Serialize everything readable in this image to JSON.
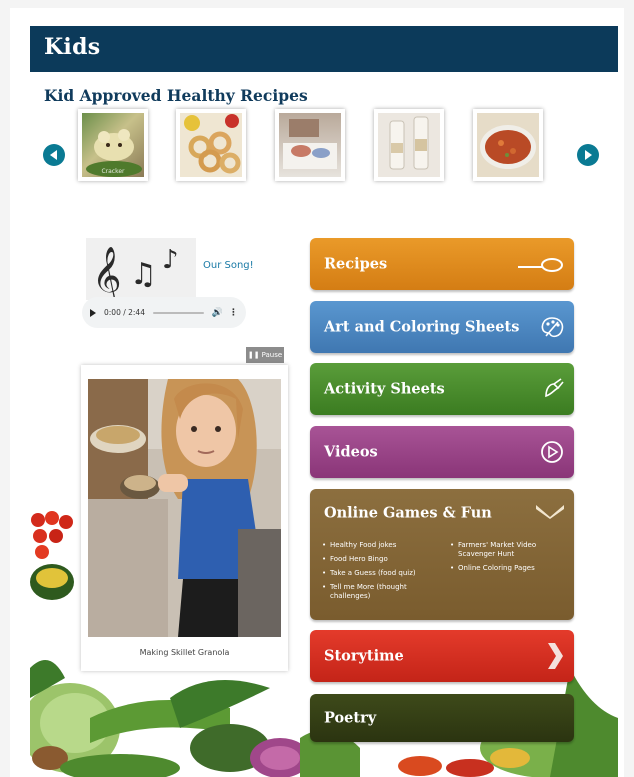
{
  "header": {
    "title": "Kids"
  },
  "recipes_section": {
    "heading": "Kid Approved Healthy Recipes",
    "thumbnails": [
      {
        "name": "recipe-thumb-1",
        "caption": "Cracker"
      },
      {
        "name": "recipe-thumb-2",
        "caption": ""
      },
      {
        "name": "recipe-thumb-3",
        "caption": ""
      },
      {
        "name": "recipe-thumb-4",
        "caption": ""
      },
      {
        "name": "recipe-thumb-5",
        "caption": ""
      }
    ]
  },
  "music": {
    "song_label": "Our Song!",
    "time": "0:00 / 2:44"
  },
  "slideshow": {
    "pause_label": "Pause",
    "caption": "Making Skillet Granola"
  },
  "menu": {
    "recipes": "Recipes",
    "art": "Art and Coloring Sheets",
    "activity": "Activity Sheets",
    "videos": "Videos",
    "games": "Online Games & Fun",
    "games_links_col1": [
      "Healthy Food jokes",
      "Food Hero Bingo",
      "Take a Guess (food quiz)",
      "Tell me More (thought challenges)"
    ],
    "games_links_col2": [
      "Farmers' Market Video Scavenger Hunt",
      "Online Coloring Pages"
    ],
    "storytime": "Storytime",
    "poetry": "Poetry"
  },
  "colors": {
    "header_bg": "#0c3a5a",
    "recipes": "#e08a1f",
    "art": "#4a86c2",
    "activity": "#4a8c2d",
    "videos": "#9a4487",
    "games": "#846636",
    "storytime": "#d4301f",
    "poetry": "#343f15",
    "arrow": "#0a7a93"
  }
}
